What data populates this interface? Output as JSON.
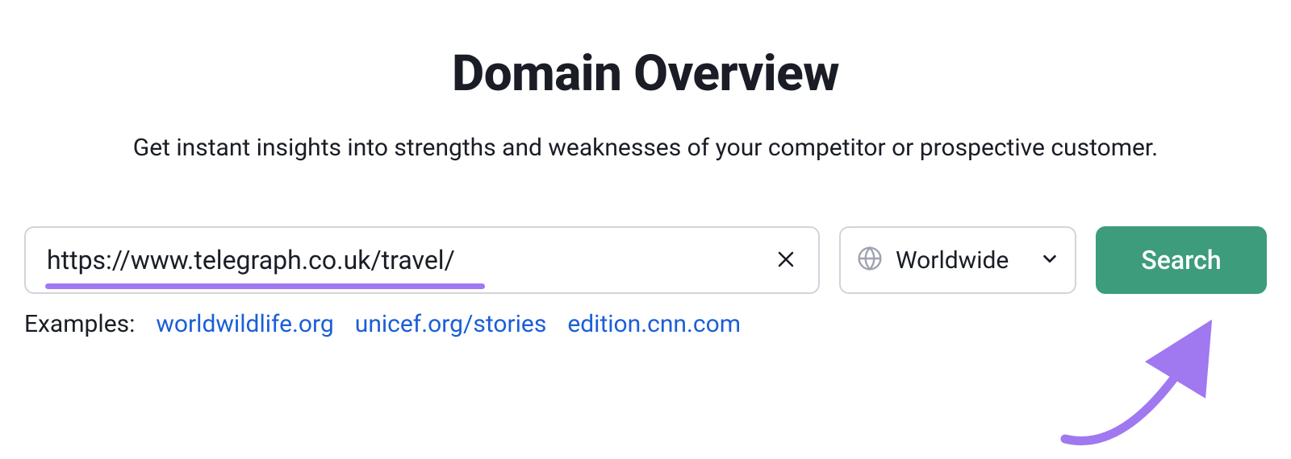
{
  "header": {
    "title": "Domain Overview",
    "subtitle": "Get instant insights into strengths and weaknesses of your competitor or prospective customer."
  },
  "search": {
    "input_value": "https://www.telegraph.co.uk/travel/",
    "region_label": "Worldwide",
    "button_label": "Search"
  },
  "examples": {
    "label": "Examples:",
    "items": [
      "worldwildlife.org",
      "unicef.org/stories",
      "edition.cnn.com"
    ]
  },
  "colors": {
    "accent_green": "#3d9c7c",
    "annotation_purple": "#a078f0",
    "link_blue": "#1b5ed8"
  }
}
